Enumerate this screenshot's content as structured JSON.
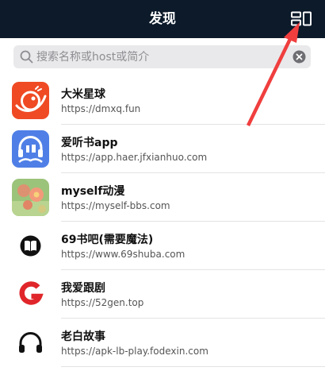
{
  "header": {
    "title": "发现",
    "layout_toggle_icon": "layout-toggle-icon"
  },
  "search": {
    "placeholder": "搜索名称或host或简介",
    "value": ""
  },
  "sites": [
    {
      "name": "大米星球",
      "url": "https://dmxq.fun",
      "icon": "planet-logo"
    },
    {
      "name": "爱听书app",
      "url": "https://app.haer.jfxianhuo.com",
      "icon": "headphones-book-logo"
    },
    {
      "name": "myself动漫",
      "url": "https://myself-bbs.com",
      "icon": "flower-thumbnail"
    },
    {
      "name": "69书吧(需要魔法)",
      "url": "https://www.69shuba.com",
      "icon": "book-icon"
    },
    {
      "name": "我爱跟剧",
      "url": "https://52gen.top",
      "icon": "letter-g-logo"
    },
    {
      "name": "老白故事",
      "url": "https://apk-lb-play.fodexin.com",
      "icon": "headphones-icon"
    }
  ],
  "colors": {
    "nav_background": "#0c1a2a",
    "annotation_arrow": "#f03e3e",
    "g_logo": "#e0262a",
    "planet_logo_bg": "#ef4a24",
    "listen_logo_bg": "#4f7fe6"
  }
}
